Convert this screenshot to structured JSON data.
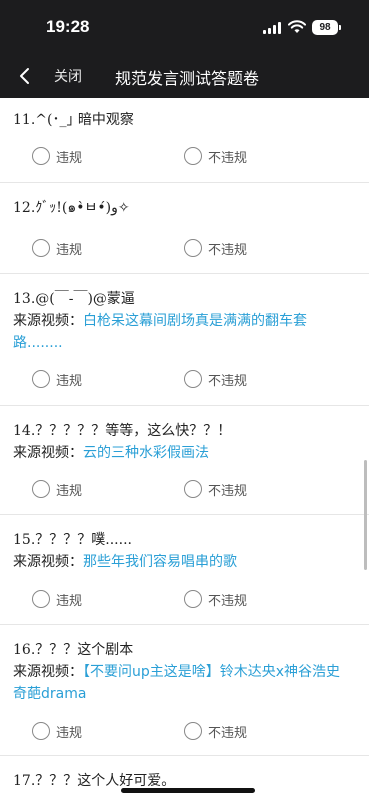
{
  "status": {
    "time": "19:28",
    "battery": "98"
  },
  "nav": {
    "close": "关闭",
    "title": "规范发言测试答题卷"
  },
  "options": {
    "violation": "违规",
    "not_violation": "不违规"
  },
  "source_label": "来源视频：",
  "questions": [
    {
      "title": "11.^(･_｣ 暗中观察"
    },
    {
      "title": "12.ｸﾞｯ!(๑•̀ㅂ•́)و✧"
    },
    {
      "title": "13.@(￣-￣)@蒙逼",
      "source": "白枪呆这幕间剧场真是满满的翻车套路........"
    },
    {
      "title": "14.？？？？？等等，这么快？？！",
      "source": "云的三种水彩假画法"
    },
    {
      "title": "15.？？？？噗......",
      "source": "那些年我们容易唱串的歌"
    },
    {
      "title": "16.？？？这个剧本",
      "source": "【不要问up主这是啥】铃木达央x神谷浩史 奇葩drama"
    },
    {
      "title": "17.？？？这个人好可爱。"
    }
  ]
}
